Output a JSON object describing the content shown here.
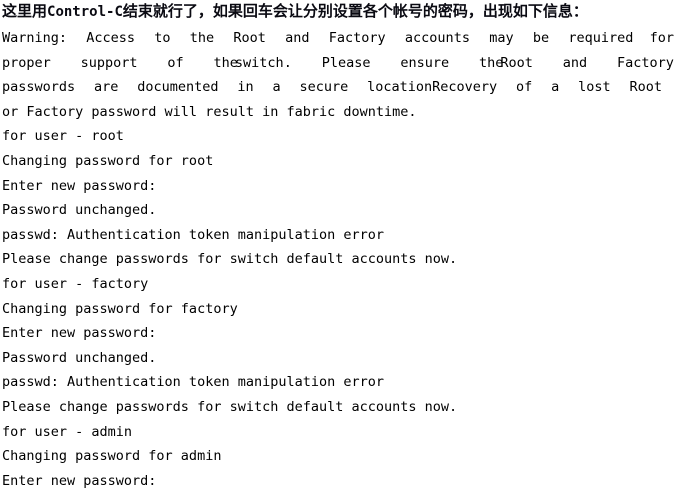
{
  "annotation": {
    "prefix": "这里用",
    "command": "Control-C",
    "suffix": "结束就行了，如果回车会让分别设置各个帐号的密码，出现如下信息："
  },
  "terminal": {
    "warning_paragraph": {
      "line1_words": [
        "Warning:",
        "Access",
        "to",
        "the",
        "Root",
        "and",
        "Factory",
        "accounts",
        "may",
        "be",
        "required",
        "for"
      ],
      "line2_words": [
        "proper",
        "support",
        "of",
        "the",
        "switch.",
        "Please",
        "ensure",
        "the",
        "Root",
        "and",
        "Factory"
      ],
      "line3_words": [
        "passwords",
        "are",
        "documented",
        "in",
        "a",
        "secure",
        "location",
        "Recovery",
        "of",
        "a",
        "lost",
        "Root"
      ],
      "line4": "or Factory password will result in fabric downtime."
    },
    "lines": [
      "for user - root",
      "Changing password for root",
      "Enter new password:",
      "Password unchanged.",
      "passwd: Authentication token manipulation error",
      "Please change passwords for switch default accounts now.",
      "for user - factory",
      "Changing password for factory",
      "Enter new password:",
      "Password unchanged.",
      "passwd: Authentication token manipulation error",
      "Please change passwords for switch default accounts now.",
      "for user - admin",
      "Changing password for admin",
      "Enter new password:"
    ]
  },
  "colors": {
    "background": "#ffffff",
    "text": "#000000",
    "annotation_text": "#0a0a12"
  }
}
